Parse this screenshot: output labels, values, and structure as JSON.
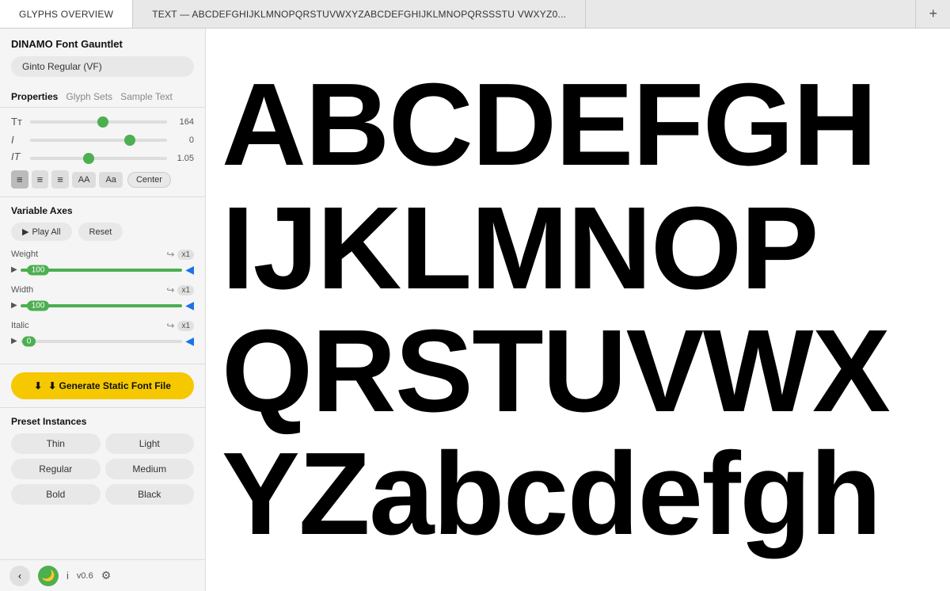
{
  "app": {
    "title": "DINAMO Font Gauntlet"
  },
  "tabs": [
    {
      "id": "glyphs",
      "label": "GLYPHS OVERVIEW",
      "active": true
    },
    {
      "id": "text",
      "label": "TEXT — ABCDEFGHIJKLMNOPQRSTUVWXYZABCDEFGHIJKLMNOPQRSSSTU VWXYZ0...",
      "active": false
    }
  ],
  "tab_plus": "+",
  "sidebar": {
    "font_selector": "Ginto Regular (VF)",
    "prop_tabs": [
      {
        "label": "Properties",
        "active": true
      },
      {
        "label": "Glyph Sets",
        "active": false
      },
      {
        "label": "Sample Text",
        "active": false
      }
    ],
    "properties": {
      "sliders": [
        {
          "icon": "Tт",
          "value": 164,
          "min": 8,
          "max": 300,
          "current": 164
        },
        {
          "icon": "I",
          "value": 0,
          "min": -100,
          "max": 100,
          "current": 0
        },
        {
          "icon": "IT",
          "value": "1.05",
          "min": 0.5,
          "max": 3,
          "current": 1.05
        }
      ],
      "align_buttons": [
        "left",
        "center",
        "right"
      ],
      "text_size_buttons": [
        "AA",
        "Aa"
      ],
      "center_button": "Center"
    },
    "variable_axes": {
      "title": "Variable Axes",
      "play_all_label": "▶ Play All",
      "reset_label": "Reset",
      "axes": [
        {
          "name": "Weight",
          "value": 100,
          "min": 0,
          "max": 100
        },
        {
          "name": "Width",
          "value": 100,
          "min": 0,
          "max": 100
        },
        {
          "name": "Italic",
          "value": 0,
          "min": 0,
          "max": 100
        }
      ]
    },
    "generate": {
      "label": "⬇ Generate Static Font File"
    },
    "presets": {
      "title": "Preset Instances",
      "items": [
        {
          "label": "Thin"
        },
        {
          "label": "Light"
        },
        {
          "label": "Regular"
        },
        {
          "label": "Medium"
        },
        {
          "label": "Bold"
        },
        {
          "label": "Black"
        }
      ]
    },
    "bottom": {
      "chevron": "‹",
      "mode_icon": "🌙",
      "info": "i",
      "version": "v0.6",
      "settings": "⚙"
    }
  },
  "preview": {
    "text": "ABCDEFGHIJKLMNOPQRSTUVWXYZabcdefgh"
  }
}
